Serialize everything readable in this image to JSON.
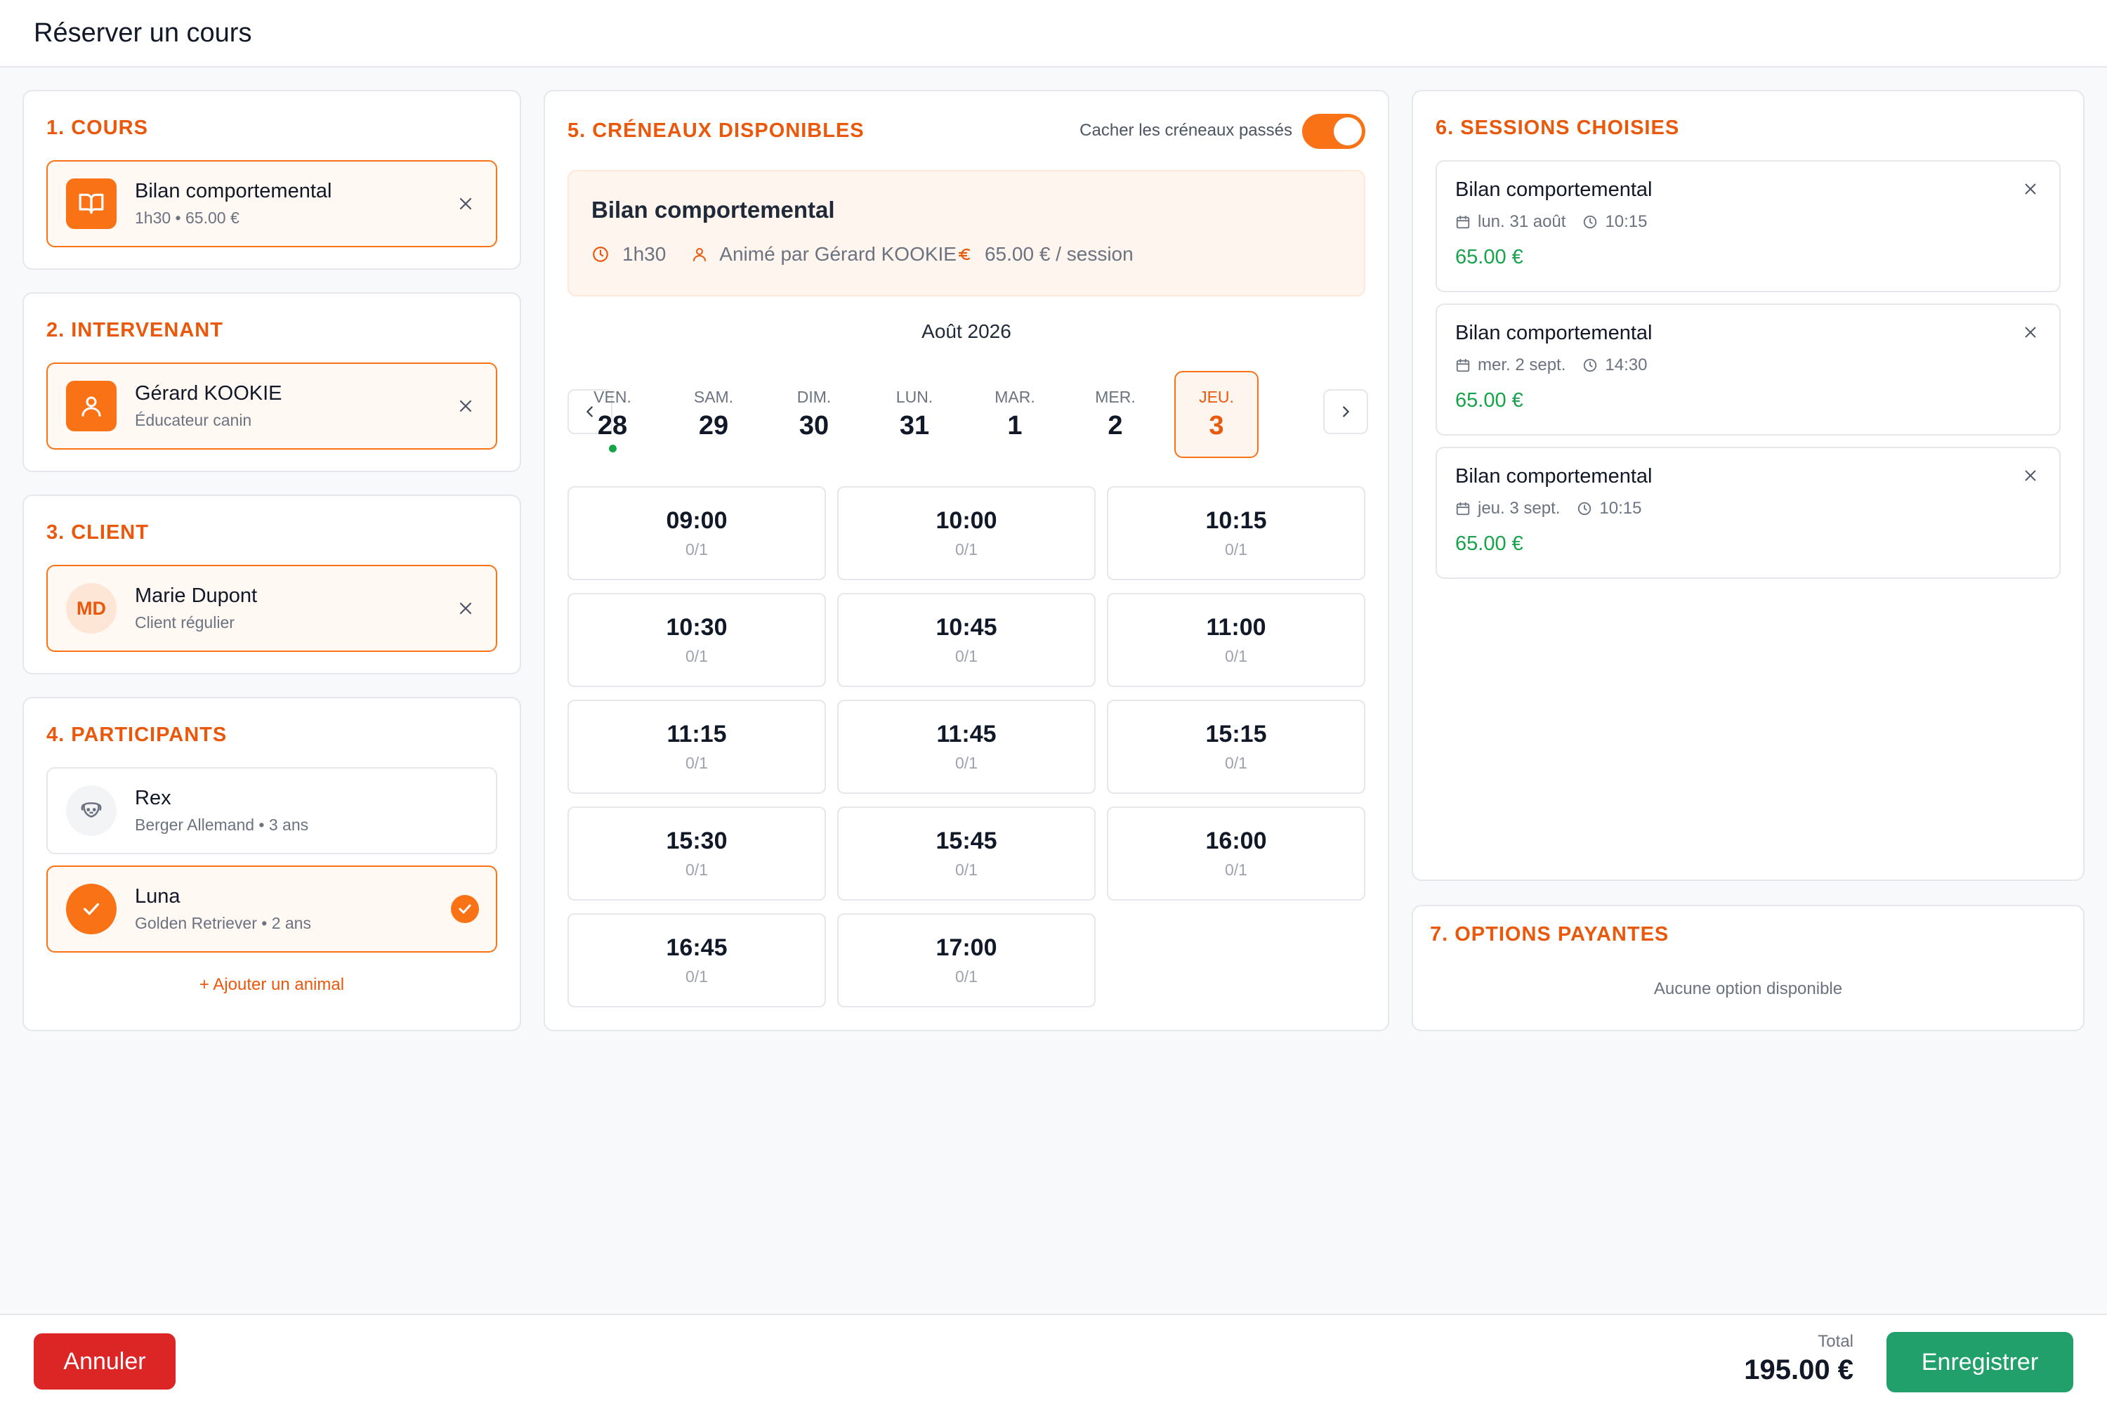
{
  "header": {
    "title": "Réserver un cours"
  },
  "left": {
    "course": {
      "title": "1. COURS",
      "name": "Bilan comportemental",
      "sub": "1h30 • 65.00 €"
    },
    "instructor": {
      "title": "2. INTERVENANT",
      "name": "Gérard KOOKIE",
      "sub": "Éducateur canin"
    },
    "client": {
      "title": "3. CLIENT",
      "initials": "MD",
      "name": "Marie Dupont",
      "sub": "Client régulier"
    },
    "participants": {
      "title": "4. PARTICIPANTS",
      "items": [
        {
          "name": "Rex",
          "sub": "Berger Allemand • 3 ans",
          "selected": false
        },
        {
          "name": "Luna",
          "sub": "Golden Retriever • 2 ans",
          "selected": true
        }
      ],
      "add_label": "+ Ajouter un animal"
    }
  },
  "slots_panel": {
    "title": "5. CRÉNEAUX DISPONIBLES",
    "toggle_label": "Cacher les créneaux passés",
    "toggle_on": true,
    "info": {
      "name": "Bilan comportemental",
      "duration": "1h30",
      "animator": "Animé par Gérard KOOKIE",
      "price": "65.00 € / session"
    },
    "month": "Août 2026",
    "days": [
      {
        "name": "VEN.",
        "num": "28",
        "selected": false,
        "dot": true
      },
      {
        "name": "SAM.",
        "num": "29",
        "selected": false,
        "dot": false
      },
      {
        "name": "DIM.",
        "num": "30",
        "selected": false,
        "dot": false
      },
      {
        "name": "LUN.",
        "num": "31",
        "selected": false,
        "dot": false
      },
      {
        "name": "MAR.",
        "num": "1",
        "selected": false,
        "dot": false
      },
      {
        "name": "MER.",
        "num": "2",
        "selected": false,
        "dot": false
      },
      {
        "name": "JEU.",
        "num": "3",
        "selected": true,
        "dot": false
      }
    ],
    "slots": [
      {
        "time": "09:00",
        "cap": "0/1"
      },
      {
        "time": "10:00",
        "cap": "0/1"
      },
      {
        "time": "10:15",
        "cap": "0/1"
      },
      {
        "time": "10:30",
        "cap": "0/1"
      },
      {
        "time": "10:45",
        "cap": "0/1"
      },
      {
        "time": "11:00",
        "cap": "0/1"
      },
      {
        "time": "11:15",
        "cap": "0/1"
      },
      {
        "time": "11:45",
        "cap": "0/1"
      },
      {
        "time": "15:15",
        "cap": "0/1"
      },
      {
        "time": "15:30",
        "cap": "0/1"
      },
      {
        "time": "15:45",
        "cap": "0/1"
      },
      {
        "time": "16:00",
        "cap": "0/1"
      },
      {
        "time": "16:45",
        "cap": "0/1"
      },
      {
        "time": "17:00",
        "cap": "0/1"
      }
    ]
  },
  "sessions": {
    "title": "6. SESSIONS CHOISIES",
    "items": [
      {
        "name": "Bilan comportemental",
        "date": "lun. 31 août",
        "time": "10:15",
        "price": "65.00 €"
      },
      {
        "name": "Bilan comportemental",
        "date": "mer. 2 sept.",
        "time": "14:30",
        "price": "65.00 €"
      },
      {
        "name": "Bilan comportemental",
        "date": "jeu. 3 sept.",
        "time": "10:15",
        "price": "65.00 €"
      }
    ]
  },
  "options": {
    "title": "7. OPTIONS PAYANTES",
    "empty": "Aucune option disponible"
  },
  "footer": {
    "cancel": "Annuler",
    "total_label": "Total",
    "total": "195.00 €",
    "save": "Enregistrer"
  },
  "colors": {
    "accent": "#f97316",
    "accent_text": "#ea580c",
    "success": "#16a34a",
    "save_btn": "#22a06b",
    "cancel_btn": "#dc2626"
  }
}
